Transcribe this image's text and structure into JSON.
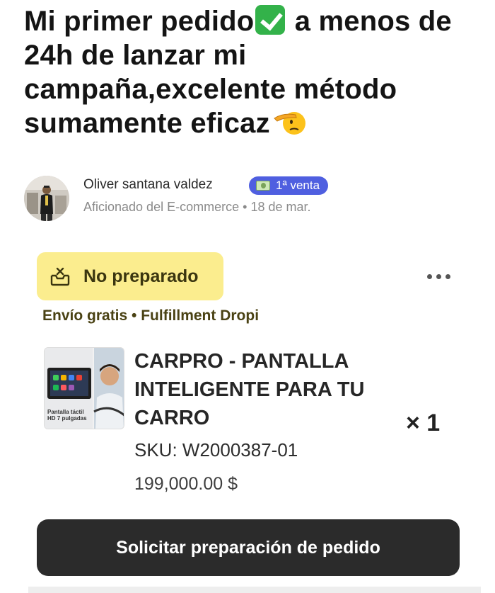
{
  "post": {
    "title_part1": "Mi primer pedido",
    "title_part2": " a menos de 24h de lanzar mi campaña,excelente método sumamente eficaz",
    "check_emoji_icon": "white-check-mark-emoji-icon",
    "salute_emoji_icon": "saluting-face-emoji-icon"
  },
  "author": {
    "name": "Oliver santana valdez",
    "badge_label": "1ª venta",
    "badge_icon": "money-bill-icon",
    "badge_color": "#4f5fe0",
    "subtitle": "Aficionado del E-commerce",
    "separator": "•",
    "date": "18 de mar."
  },
  "order": {
    "status_label": "No preparado",
    "status_color": "#fbed8e",
    "status_icon": "box-unprepared-icon",
    "more_icon": "more-horizontal-icon",
    "shipping_info": "Envío gratis • Fulfillment Dropi",
    "product": {
      "title": "CARPRO - PANTALLA INTELIGENTE PARA TU CARRO",
      "thumbnail_caption_line1": "Pantalla táctil",
      "thumbnail_caption_line2": "HD 7 pulgadas",
      "quantity": "× 1",
      "sku": "SKU: W2000387-01",
      "price": "199,000.00 $"
    },
    "action_button_label": "Solicitar preparación de pedido",
    "action_button_color": "#2b2b2b"
  }
}
